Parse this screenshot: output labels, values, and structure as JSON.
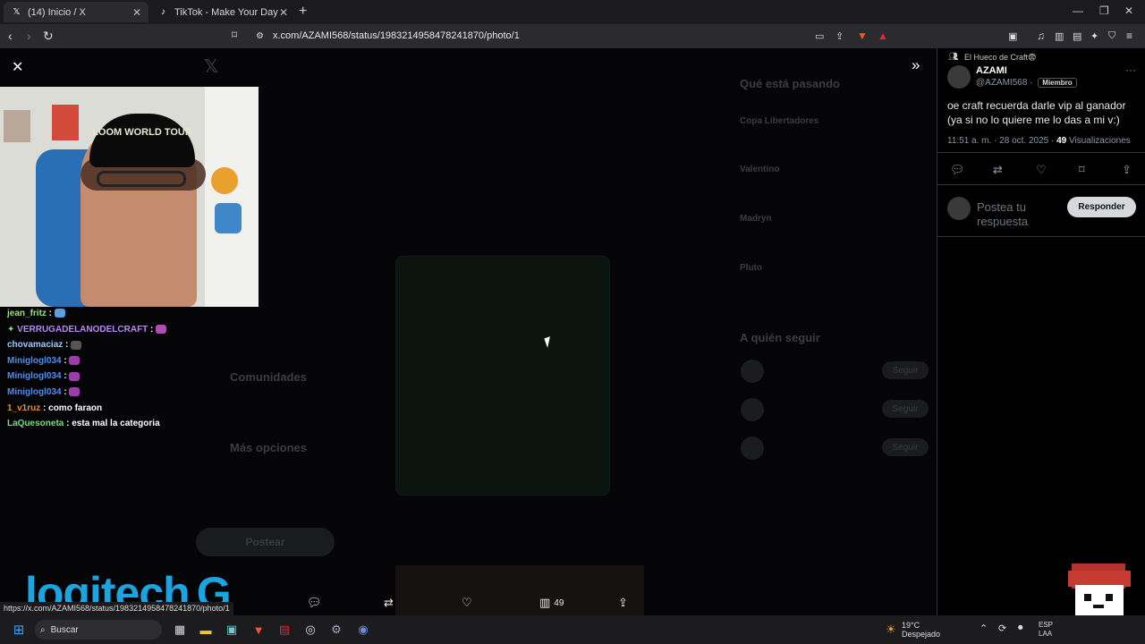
{
  "browser": {
    "tabs": [
      {
        "title": "(14) Inicio / X",
        "icon": "x-logo-icon",
        "active": true
      },
      {
        "title": "TikTok - Make Your Day",
        "icon": "tiktok-icon",
        "active": false
      }
    ],
    "url": "x.com/AZAMI568/status/1983214958478241870/photo/1",
    "status_url": "https://x.com/AZAMI568/status/1983214958478241870/photo/1"
  },
  "background": {
    "trending_title": "Qué está pasando",
    "trends": [
      "Copa Libertadores",
      "Valentino",
      "Madryn",
      "Pluto"
    ],
    "follow_title": "A quién seguir",
    "follow_label": "Seguir",
    "post_button": "Postear",
    "nav": [
      "Comunidades",
      "Más opciones"
    ]
  },
  "webcam": {
    "cap_text": "LOOM WORLD TOUR"
  },
  "chat": [
    {
      "user": "jean_fritz",
      "color": "#9be07a",
      "text": "",
      "emote": "#5aa0e0",
      "badge": false
    },
    {
      "user": "VERRUGADELANODELCRAFT",
      "color": "#b58af0",
      "text": "",
      "emote": "#b04bb0",
      "badge": true
    },
    {
      "user": "chovamaciaz",
      "color": "#9fc7ff",
      "text": "",
      "emote": "#555555",
      "badge": false
    },
    {
      "user": "Miniglogl034",
      "color": "#4f8df0",
      "text": "",
      "emote": "#a03ab0",
      "badge": false
    },
    {
      "user": "Miniglogl034",
      "color": "#4f8df0",
      "text": "",
      "emote": "#a03ab0",
      "badge": false
    },
    {
      "user": "Miniglogl034",
      "color": "#4f8df0",
      "text": "",
      "emote": "#a03ab0",
      "badge": false
    },
    {
      "user": "1_v1ruz",
      "color": "#e0903a",
      "text": "como faraon",
      "emote": "",
      "badge": false
    },
    {
      "user": "LaQuesoneta",
      "color": "#6fe07a",
      "text": "esta mal la categoria",
      "emote": "",
      "badge": false
    }
  ],
  "overlay": {
    "logo_text": "logitech",
    "actions": {
      "views": "49"
    }
  },
  "post": {
    "community": "El Hueco de Craft😨",
    "name": "AZAMI",
    "handle": "@AZAMI568",
    "badge": "Miembro",
    "text": "oe craft recuerda darle vip al ganador (ya si no lo quiere me lo das a mi v:)",
    "time": "11:51 a. m. · 28 oct. 2025 ·",
    "views": "49",
    "views_label": "Visualizaciones",
    "reply_placeholder": "Postea tu respuesta",
    "reply_button": "Responder"
  },
  "taskbar": {
    "search_label": "Buscar",
    "temp": "19°C",
    "condition": "Despejado",
    "lang1": "ESP",
    "lang2": "LAA"
  },
  "colors": {
    "accent": "#1d9bf0",
    "logitech": "#1aa4e0"
  }
}
